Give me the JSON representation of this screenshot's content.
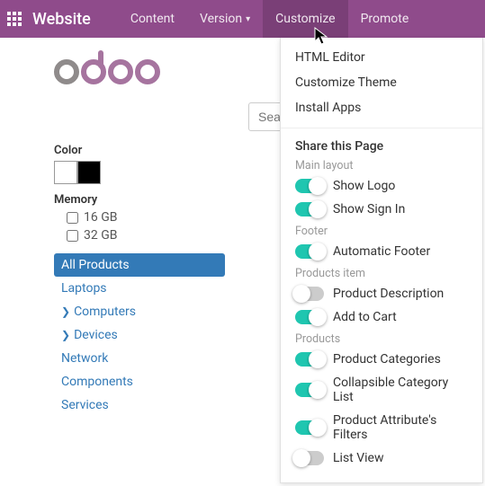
{
  "navbar": {
    "brand": "Website",
    "items": [
      "Content",
      "Version",
      "Customize",
      "Promote"
    ],
    "active_index": 2
  },
  "search": {
    "placeholder": "Search..."
  },
  "filters": {
    "color_label": "Color",
    "memory_label": "Memory",
    "memory_options": [
      "16 GB",
      "32 GB"
    ]
  },
  "categories": {
    "items": [
      {
        "label": "All Products",
        "active": true,
        "expandable": false
      },
      {
        "label": "Laptops",
        "active": false,
        "expandable": false
      },
      {
        "label": "Computers",
        "active": false,
        "expandable": true
      },
      {
        "label": "Devices",
        "active": false,
        "expandable": true
      },
      {
        "label": "Network",
        "active": false,
        "expandable": false
      },
      {
        "label": "Components",
        "active": false,
        "expandable": false
      },
      {
        "label": "Services",
        "active": false,
        "expandable": false
      }
    ]
  },
  "dropdown": {
    "links": [
      "HTML Editor",
      "Customize Theme",
      "Install Apps"
    ],
    "share_heading": "Share this Page",
    "groups": [
      {
        "title": "Main layout",
        "toggles": [
          {
            "label": "Show Logo",
            "on": true
          },
          {
            "label": "Show Sign In",
            "on": true
          }
        ]
      },
      {
        "title": "Footer",
        "toggles": [
          {
            "label": "Automatic Footer",
            "on": true
          }
        ]
      },
      {
        "title": "Products item",
        "toggles": [
          {
            "label": "Product Description",
            "on": false
          },
          {
            "label": "Add to Cart",
            "on": true
          }
        ]
      },
      {
        "title": "Products",
        "toggles": [
          {
            "label": "Product Categories",
            "on": true
          },
          {
            "label": "Collapsible Category List",
            "on": true
          },
          {
            "label": "Product Attribute's Filters",
            "on": true
          },
          {
            "label": "List View",
            "on": false
          }
        ]
      }
    ]
  },
  "colors": {
    "accent_teal": "#1fc6b0",
    "accent_purple": "#8f4b8b",
    "link": "#337ab7"
  }
}
